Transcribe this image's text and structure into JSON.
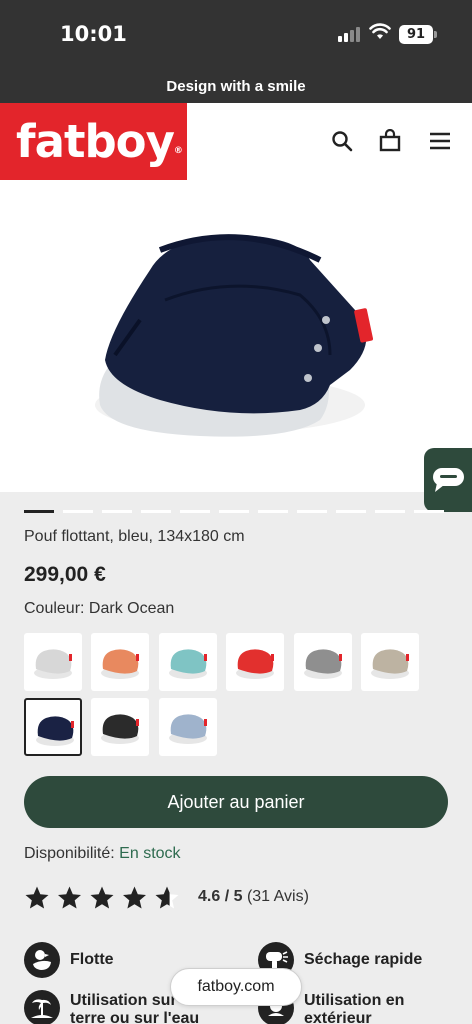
{
  "status_bar": {
    "time": "10:01",
    "battery": "91"
  },
  "promo": "Design with a smile",
  "header": {
    "logo": "fatboy"
  },
  "product": {
    "title": "Pouf flottant, bleu, 134x180 cm",
    "price": "299,00 €",
    "color_label": "Couleur: Dark Ocean",
    "image_count": 11,
    "active_image": 1
  },
  "swatches": [
    {
      "color": "#d7d7d7"
    },
    {
      "color": "#e8895f"
    },
    {
      "color": "#7fc4c4"
    },
    {
      "color": "#e2302e"
    },
    {
      "color": "#8f8f8f"
    },
    {
      "color": "#bdb3a2"
    },
    {
      "color": "#1a2244",
      "selected": true
    },
    {
      "color": "#2b2b2b"
    },
    {
      "color": "#9fb3cc"
    }
  ],
  "cart_button": "Ajouter au panier",
  "availability": {
    "label": "Disponibilité:",
    "value": "En stock"
  },
  "rating": {
    "score": "4.6 / 5",
    "count": "(31 Avis)",
    "stars": 4.6
  },
  "features": [
    {
      "label": "Flotte",
      "icon": "duck-icon"
    },
    {
      "label": "Séchage rapide",
      "icon": "hairdryer-icon"
    },
    {
      "label": "Utilisation sur terre ou sur l'eau",
      "icon": "island-icon"
    },
    {
      "label": "Utilisation en extérieur",
      "icon": "outdoor-icon"
    }
  ],
  "url_bar": "fatboy.com",
  "colors": {
    "accent_green": "#2e4a3c",
    "brand_red": "#e3252b",
    "dark_bar": "#333333"
  }
}
